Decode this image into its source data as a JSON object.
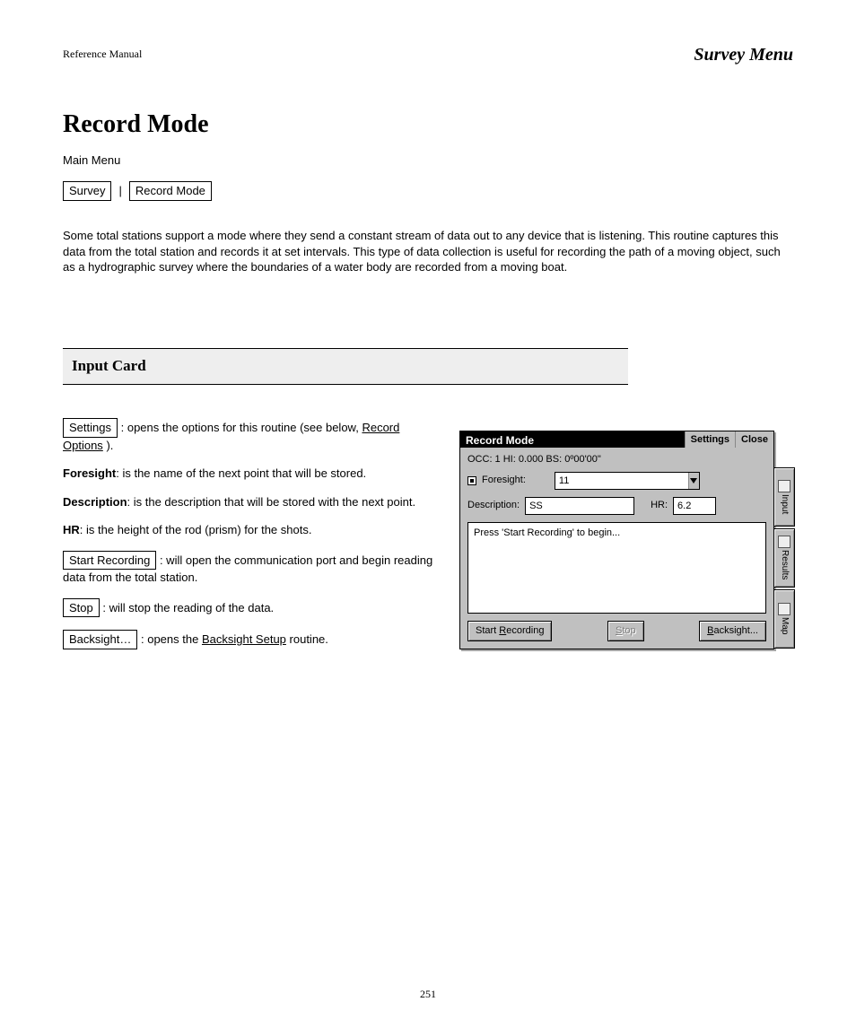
{
  "header": {
    "left": "Reference Manual",
    "right": "Survey Menu"
  },
  "h1": "Record Mode",
  "intro_line1": "Main Menu",
  "menu_path": {
    "item1": "Survey",
    "item2": "Record Mode"
  },
  "para2": "Some total stations support a mode where they send a constant stream of data out to any device that is listening. This routine captures this data from the total station and records it at set intervals. This type of data collection is useful for recording the path of a moving object, such as a hydrographic survey where the boundaries of a water body are recorded from a moving boat.",
  "h2": "Input Card",
  "body": {
    "settings_btn": "Settings",
    "settings_text": ": opens the options for this routine (see below, ",
    "settings_xref": "Record Options",
    "settings_tail": ").",
    "foresight_label_bold": "Foresight",
    "foresight_text": ": is the name of the next point that will be stored.",
    "description_label_bold": "Description",
    "description_text": ": is the description that will be stored with the next point.",
    "hr_label_bold": "HR",
    "hr_text": ": is the height of the rod (prism) for the shots.",
    "start_btn": "Start Recording",
    "start_text": ": will open the communication port and begin reading data from the total station.",
    "stop_btn": "Stop",
    "stop_text": ": will stop the reading of the data.",
    "backsight_btn": "Backsight…",
    "backsight_text": ": opens the ",
    "backsight_xref": "Backsight Setup",
    "backsight_tail": " routine."
  },
  "dialog": {
    "title": "Record Mode",
    "settings": "Settings",
    "close": "Close",
    "status": "OCC: 1  HI: 0.000  BS: 0º00'00\"",
    "foresight_label": "Foresight:",
    "foresight_value": "11",
    "description_label": "Description:",
    "description_value": "SS",
    "hr_label": "HR:",
    "hr_value": "6.2",
    "message": "Press 'Start Recording' to begin...",
    "btn_start_pre": "Start ",
    "btn_start_mn": "R",
    "btn_start_post": "ecording",
    "btn_stop_mn": "S",
    "btn_stop_post": "top",
    "btn_back_mn": "B",
    "btn_back_post": "acksight...",
    "tab_input": "Input",
    "tab_results": "Results",
    "tab_map": "Map"
  },
  "footer": "251"
}
